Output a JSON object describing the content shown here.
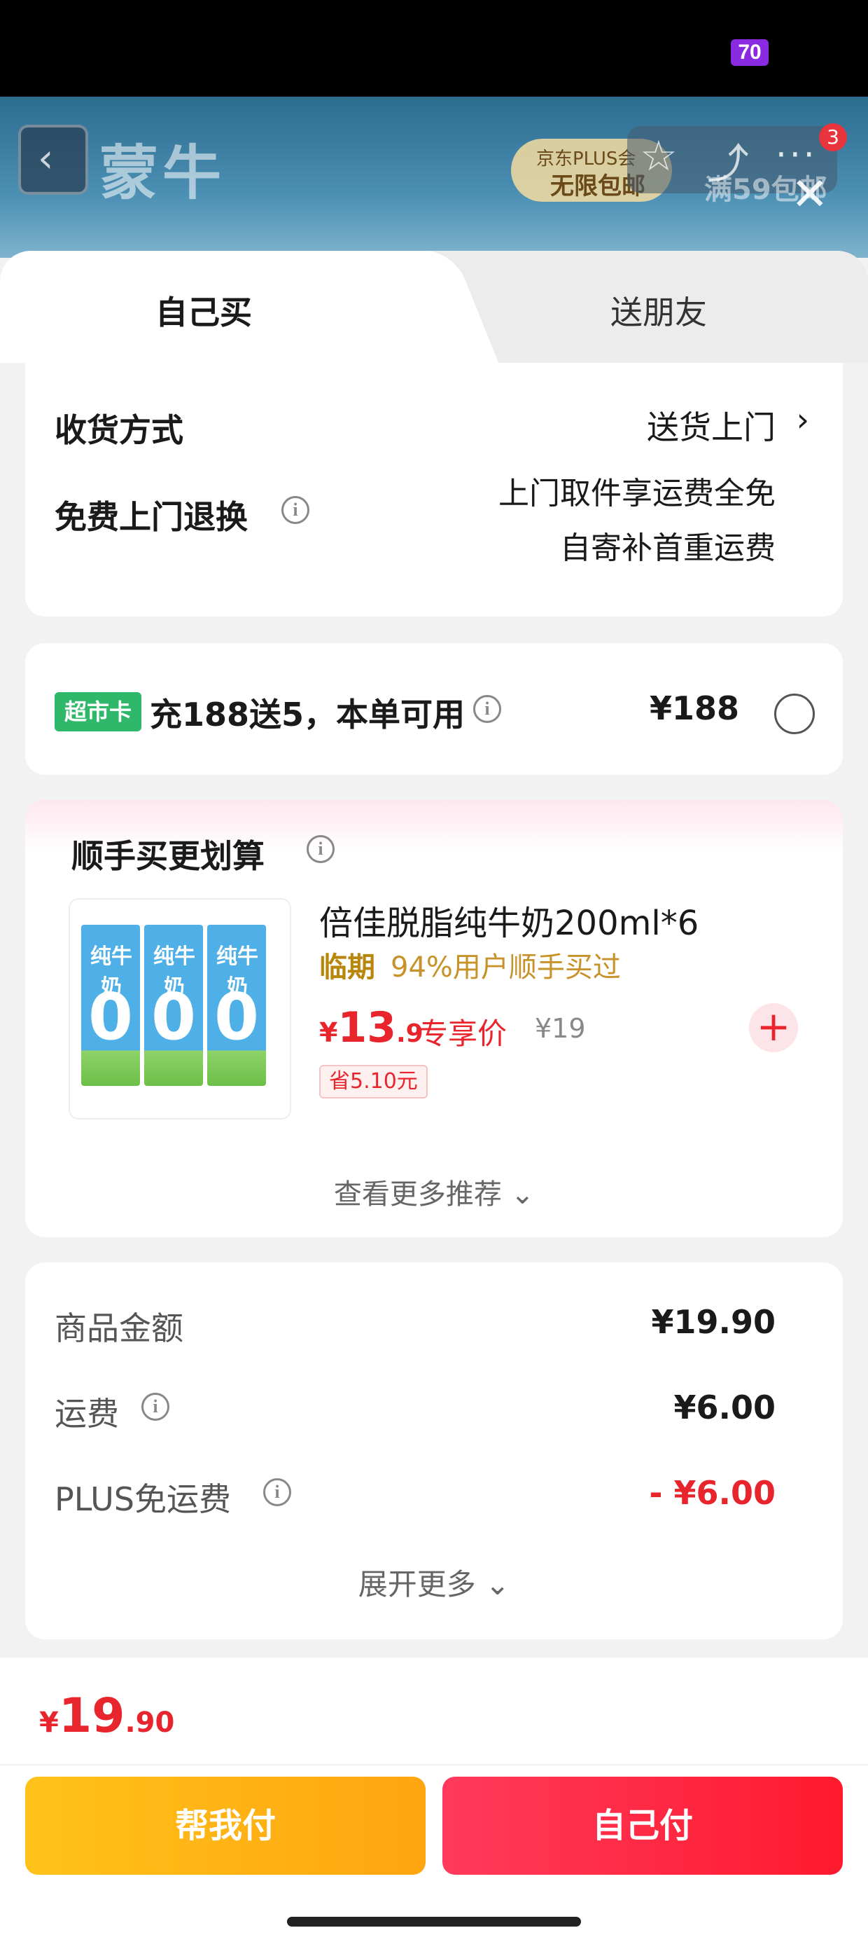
{
  "status_bar": {
    "battery": "70"
  },
  "background_page": {
    "brand": "蒙牛",
    "promo_line1": "京东PLUS会",
    "promo_line2": "无限包邮",
    "shipping_banner": "满59包邮",
    "cart_badge": "3"
  },
  "tabs": [
    {
      "label": "自己买",
      "active": true
    },
    {
      "label": "送朋友",
      "active": false
    }
  ],
  "delivery": {
    "method_label": "收货方式",
    "method_value": "送货上门",
    "return_label": "免费上门退换",
    "return_line1": "上门取件享运费全免",
    "return_line2": "自寄补首重运费"
  },
  "card_offer": {
    "tag": "超市卡",
    "text": "充188送5，本单可用",
    "price": "¥188"
  },
  "addon": {
    "title": "顺手买更划算",
    "product_name": "倍佳脱脂纯牛奶200ml*6",
    "badge": "临期",
    "buy_rate": "94%用户顺手买过",
    "price_symbol": "¥",
    "price_int": "13",
    "price_dec": ".9",
    "price_label": "专享价",
    "original_price": "¥19",
    "save": "省5.10元",
    "carton_name": "纯牛奶",
    "carton_zero": "0",
    "more": "查看更多推荐"
  },
  "fees": [
    {
      "label": "商品金额",
      "value": "¥19.90",
      "info": false,
      "red": false
    },
    {
      "label": "运费",
      "value": "¥6.00",
      "info": true,
      "red": false
    },
    {
      "label": "PLUS免运费",
      "value": "- ¥6.00",
      "info": true,
      "red": true
    }
  ],
  "expand_more": "展开更多",
  "total": {
    "symbol": "¥",
    "int": "19",
    "dec": ".90"
  },
  "buttons": {
    "help_pay": "帮我付",
    "self_pay": "自己付"
  },
  "colors": {
    "accent_red": "#e8252c",
    "green_tag": "#2fb86a",
    "help_btn": "#ffb31a",
    "self_btn": "#ff2a45"
  }
}
